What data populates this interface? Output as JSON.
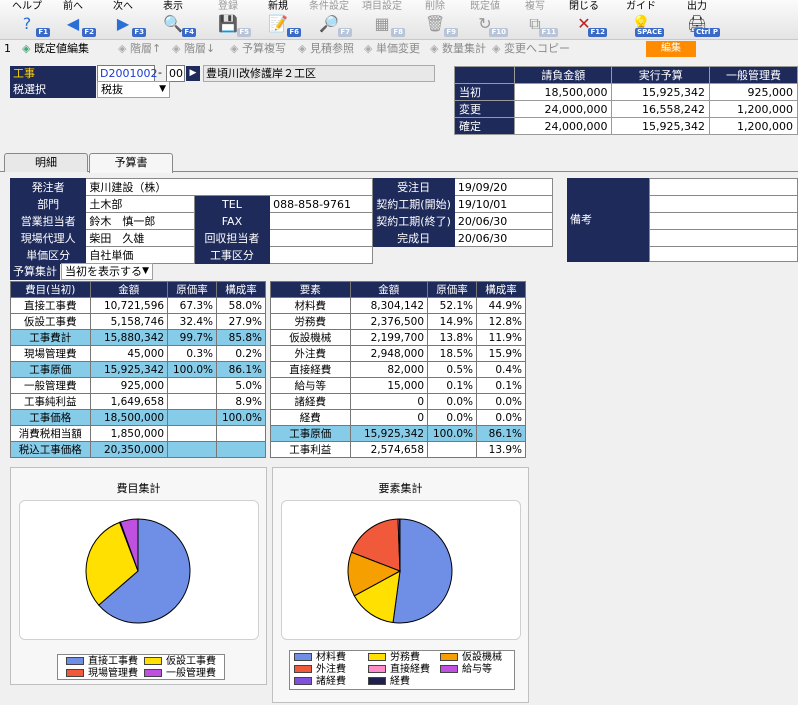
{
  "toolbar": [
    {
      "name": "help",
      "label": "ヘルプ",
      "key": "F1",
      "icon": "?",
      "color": "#2a6fd6",
      "disabled": false
    },
    {
      "name": "prev",
      "label": "前へ",
      "key": "F2",
      "icon": "◀",
      "color": "#2a6fd6",
      "disabled": false
    },
    {
      "name": "next",
      "label": "次へ",
      "key": "F3",
      "icon": "▶",
      "color": "#2a6fd6",
      "disabled": false
    },
    {
      "name": "display",
      "label": "表示",
      "key": "F4",
      "icon": "🔍",
      "color": "#333",
      "disabled": false
    },
    {
      "name": "register",
      "label": "登録",
      "key": "F5",
      "icon": "💾",
      "color": "#999",
      "disabled": true
    },
    {
      "name": "new",
      "label": "新規",
      "key": "F6",
      "icon": "📝",
      "color": "#333",
      "disabled": false
    },
    {
      "name": "condition",
      "label": "条件設定",
      "key": "F7",
      "icon": "🔎",
      "color": "#999",
      "disabled": true
    },
    {
      "name": "item-setting",
      "label": "項目設定",
      "key": "F8",
      "icon": "▦",
      "color": "#999",
      "disabled": true
    },
    {
      "name": "delete",
      "label": "削除",
      "key": "F9",
      "icon": "🗑",
      "color": "#999",
      "disabled": true
    },
    {
      "name": "default",
      "label": "既定値",
      "key": "F10",
      "icon": "↻",
      "color": "#999",
      "disabled": true
    },
    {
      "name": "copy",
      "label": "複写",
      "key": "F11",
      "icon": "⧉",
      "color": "#999",
      "disabled": true
    },
    {
      "name": "close",
      "label": "閉じる",
      "key": "F12",
      "icon": "✕",
      "color": "#c02020",
      "disabled": false
    },
    {
      "name": "guide",
      "label": "ガイド",
      "key": "SPACE",
      "icon": "💡",
      "color": "#e0a000",
      "disabled": false
    },
    {
      "name": "output",
      "label": "出力",
      "key": "Ctrl P",
      "icon": "🖨",
      "color": "#333",
      "disabled": false
    }
  ],
  "row2": [
    {
      "name": "page-num",
      "label": "1",
      "disabled": false
    },
    {
      "name": "default-edit",
      "label": "既定値編集",
      "disabled": false
    },
    {
      "name": "level-up",
      "label": "階層↑",
      "disabled": true
    },
    {
      "name": "level-down",
      "label": "階層↓",
      "disabled": true
    },
    {
      "name": "budget-copy",
      "label": "予算複写",
      "disabled": true
    },
    {
      "name": "estimate-ref",
      "label": "見積参照",
      "disabled": true
    },
    {
      "name": "unit-price-change",
      "label": "単価変更",
      "disabled": true
    },
    {
      "name": "qty-sum",
      "label": "数量集計",
      "disabled": true
    },
    {
      "name": "change-copy",
      "label": "変更へコピー",
      "disabled": true
    }
  ],
  "edit_label": "編集",
  "header": {
    "koji_label": "工事",
    "koji_code": "D2001002",
    "koji_sep": "-",
    "koji_sub": "00",
    "koji_name": "豊頃川改修護岸２工区",
    "tax_label": "税選択",
    "tax_value": "税抜"
  },
  "summary": {
    "cols": [
      "請負金額",
      "実行予算",
      "一般管理費"
    ],
    "rows": [
      {
        "label": "当初",
        "values": [
          "18,500,000",
          "15,925,342",
          "925,000"
        ]
      },
      {
        "label": "変更",
        "values": [
          "24,000,000",
          "16,558,242",
          "1,200,000"
        ]
      },
      {
        "label": "確定",
        "values": [
          "24,000,000",
          "15,925,342",
          "1,200,000"
        ]
      }
    ]
  },
  "tabs": [
    {
      "label": "明細"
    },
    {
      "label": "予算書"
    }
  ],
  "info": {
    "orderer_label": "発注者",
    "orderer": "東川建設（株）",
    "dept_label": "部門",
    "dept": "土木部",
    "sales_label": "営業担当者",
    "sales": "鈴木　慎一郎",
    "agent_label": "現場代理人",
    "agent": "柴田　久雄",
    "unit_label": "単価区分",
    "unit": "自社単価",
    "tel_label": "TEL",
    "tel": "088-858-9761",
    "fax_label": "FAX",
    "fax": "",
    "collector_label": "回収担当者",
    "collector": "",
    "kind_label": "工事区分",
    "kind": "",
    "recv_label": "受注日",
    "recv": "19/09/20",
    "start_label": "契約工期(開始)",
    "start": "19/10/01",
    "end_label": "契約工期(終了)",
    "end": "20/06/30",
    "done_label": "完成日",
    "done": "20/06/30",
    "remarks_label": "備考"
  },
  "budget_sum": {
    "label": "予算集計",
    "select": "当初を表示する"
  },
  "left_table": {
    "headers": [
      "費目(当初)",
      "金額",
      "原価率",
      "構成率"
    ],
    "rows": [
      {
        "c": [
          "直接工事費",
          "10,721,596",
          "67.3%",
          "58.0%"
        ],
        "hl": false
      },
      {
        "c": [
          "仮設工事費",
          "5,158,746",
          "32.4%",
          "27.9%"
        ],
        "hl": false
      },
      {
        "c": [
          "工事費計",
          "15,880,342",
          "99.7%",
          "85.8%"
        ],
        "hl": true
      },
      {
        "c": [
          "現場管理費",
          "45,000",
          "0.3%",
          "0.2%"
        ],
        "hl": false
      },
      {
        "c": [
          "工事原価",
          "15,925,342",
          "100.0%",
          "86.1%"
        ],
        "hl": true
      },
      {
        "c": [
          "一般管理費",
          "925,000",
          "",
          "5.0%"
        ],
        "hl": false
      },
      {
        "c": [
          "工事純利益",
          "1,649,658",
          "",
          "8.9%"
        ],
        "hl": false
      },
      {
        "c": [
          "工事価格",
          "18,500,000",
          "",
          "100.0%"
        ],
        "hl": true
      },
      {
        "c": [
          "消費税相当額",
          "1,850,000",
          "",
          ""
        ],
        "hl": false
      },
      {
        "c": [
          "税込工事価格",
          "20,350,000",
          "",
          ""
        ],
        "hl": true
      }
    ]
  },
  "right_table": {
    "headers": [
      "要素",
      "金額",
      "原価率",
      "構成率"
    ],
    "rows": [
      {
        "c": [
          "材料費",
          "8,304,142",
          "52.1%",
          "44.9%"
        ],
        "hl": false
      },
      {
        "c": [
          "労務費",
          "2,376,500",
          "14.9%",
          "12.8%"
        ],
        "hl": false
      },
      {
        "c": [
          "仮設機械",
          "2,199,700",
          "13.8%",
          "11.9%"
        ],
        "hl": false
      },
      {
        "c": [
          "外注費",
          "2,948,000",
          "18.5%",
          "15.9%"
        ],
        "hl": false
      },
      {
        "c": [
          "直接経費",
          "82,000",
          "0.5%",
          "0.4%"
        ],
        "hl": false
      },
      {
        "c": [
          "給与等",
          "15,000",
          "0.1%",
          "0.1%"
        ],
        "hl": false
      },
      {
        "c": [
          "諸経費",
          "0",
          "0.0%",
          "0.0%"
        ],
        "hl": false
      },
      {
        "c": [
          "経費",
          "0",
          "0.0%",
          "0.0%"
        ],
        "hl": false
      },
      {
        "c": [
          "工事原価",
          "15,925,342",
          "100.0%",
          "86.1%"
        ],
        "hl": true
      },
      {
        "c": [
          "工事利益",
          "2,574,658",
          "",
          "13.9%"
        ],
        "hl": false
      }
    ]
  },
  "chart_data": [
    {
      "type": "pie",
      "title": "費目集計",
      "categories": [
        "直接工事費",
        "仮設工事費",
        "現場管理費",
        "一般管理費"
      ],
      "values": [
        10721596,
        5158746,
        45000,
        925000
      ],
      "colors": [
        "#6f8fe6",
        "#ffe000",
        "#f05a3a",
        "#c050e0"
      ],
      "legend": "bottom"
    },
    {
      "type": "pie",
      "title": "要素集計",
      "categories": [
        "材料費",
        "労務費",
        "仮設機械",
        "外注費",
        "直接経費",
        "給与等",
        "諸経費",
        "経費"
      ],
      "values": [
        8304142,
        2376500,
        2199700,
        2948000,
        82000,
        15000,
        0,
        0
      ],
      "colors": [
        "#6f8fe6",
        "#ffe000",
        "#f5a000",
        "#f05a3a",
        "#ff8cc8",
        "#c050e0",
        "#8050e0",
        "#202050"
      ],
      "legend": "bottom"
    }
  ]
}
